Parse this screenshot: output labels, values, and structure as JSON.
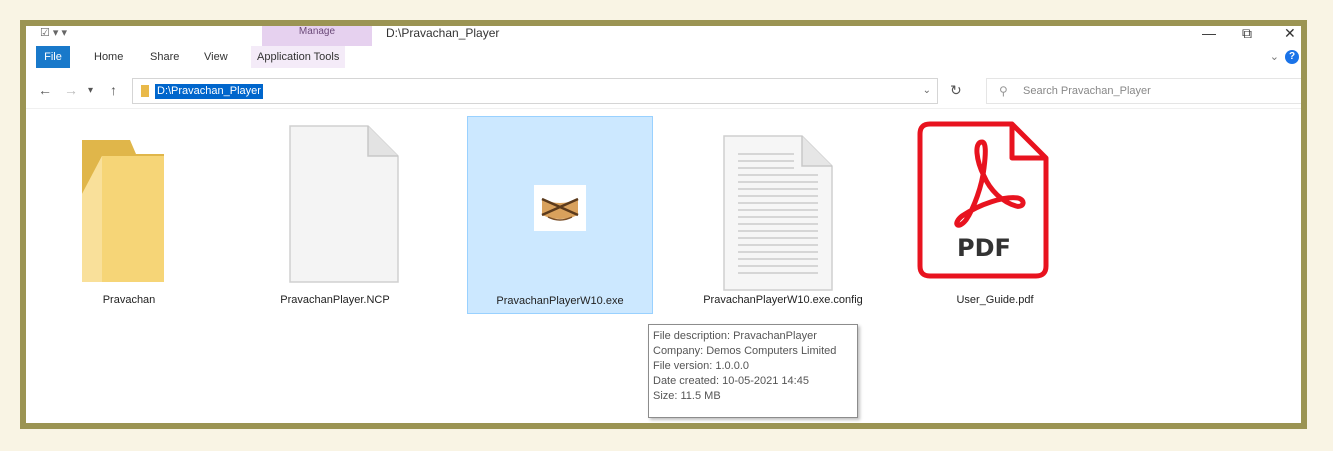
{
  "window": {
    "title": "D:\\Pravachan_Player",
    "context_tab": "Manage"
  },
  "ribbon": {
    "tabs": [
      {
        "label": "File"
      },
      {
        "label": "Home"
      },
      {
        "label": "Share"
      },
      {
        "label": "View"
      },
      {
        "label": "Application Tools"
      }
    ]
  },
  "address": {
    "path": "D:\\Pravachan_Player"
  },
  "search": {
    "placeholder": "Search Pravachan_Player"
  },
  "files": [
    {
      "name": "Pravachan",
      "type": "folder"
    },
    {
      "name": "PravachanPlayer.NCP",
      "type": "blank-file"
    },
    {
      "name": "PravachanPlayerW10.exe",
      "type": "exe",
      "selected": true
    },
    {
      "name": "PravachanPlayerW10.exe.config",
      "type": "text-file"
    },
    {
      "name": "User_Guide.pdf",
      "type": "pdf"
    }
  ],
  "pdf_label": "PDF",
  "tooltip": {
    "lines": [
      "File description: PravachanPlayer",
      "Company: Demos Computers Limited",
      "File version: 1.0.0.0",
      "Date created: 10-05-2021 14:45",
      "Size: 11.5 MB"
    ]
  },
  "colors": {
    "frame": "#9b9453",
    "file_tab": "#1979ca",
    "selection": "#cce8ff",
    "pdf_red": "#e8131f",
    "folder": "#f4cd68"
  }
}
